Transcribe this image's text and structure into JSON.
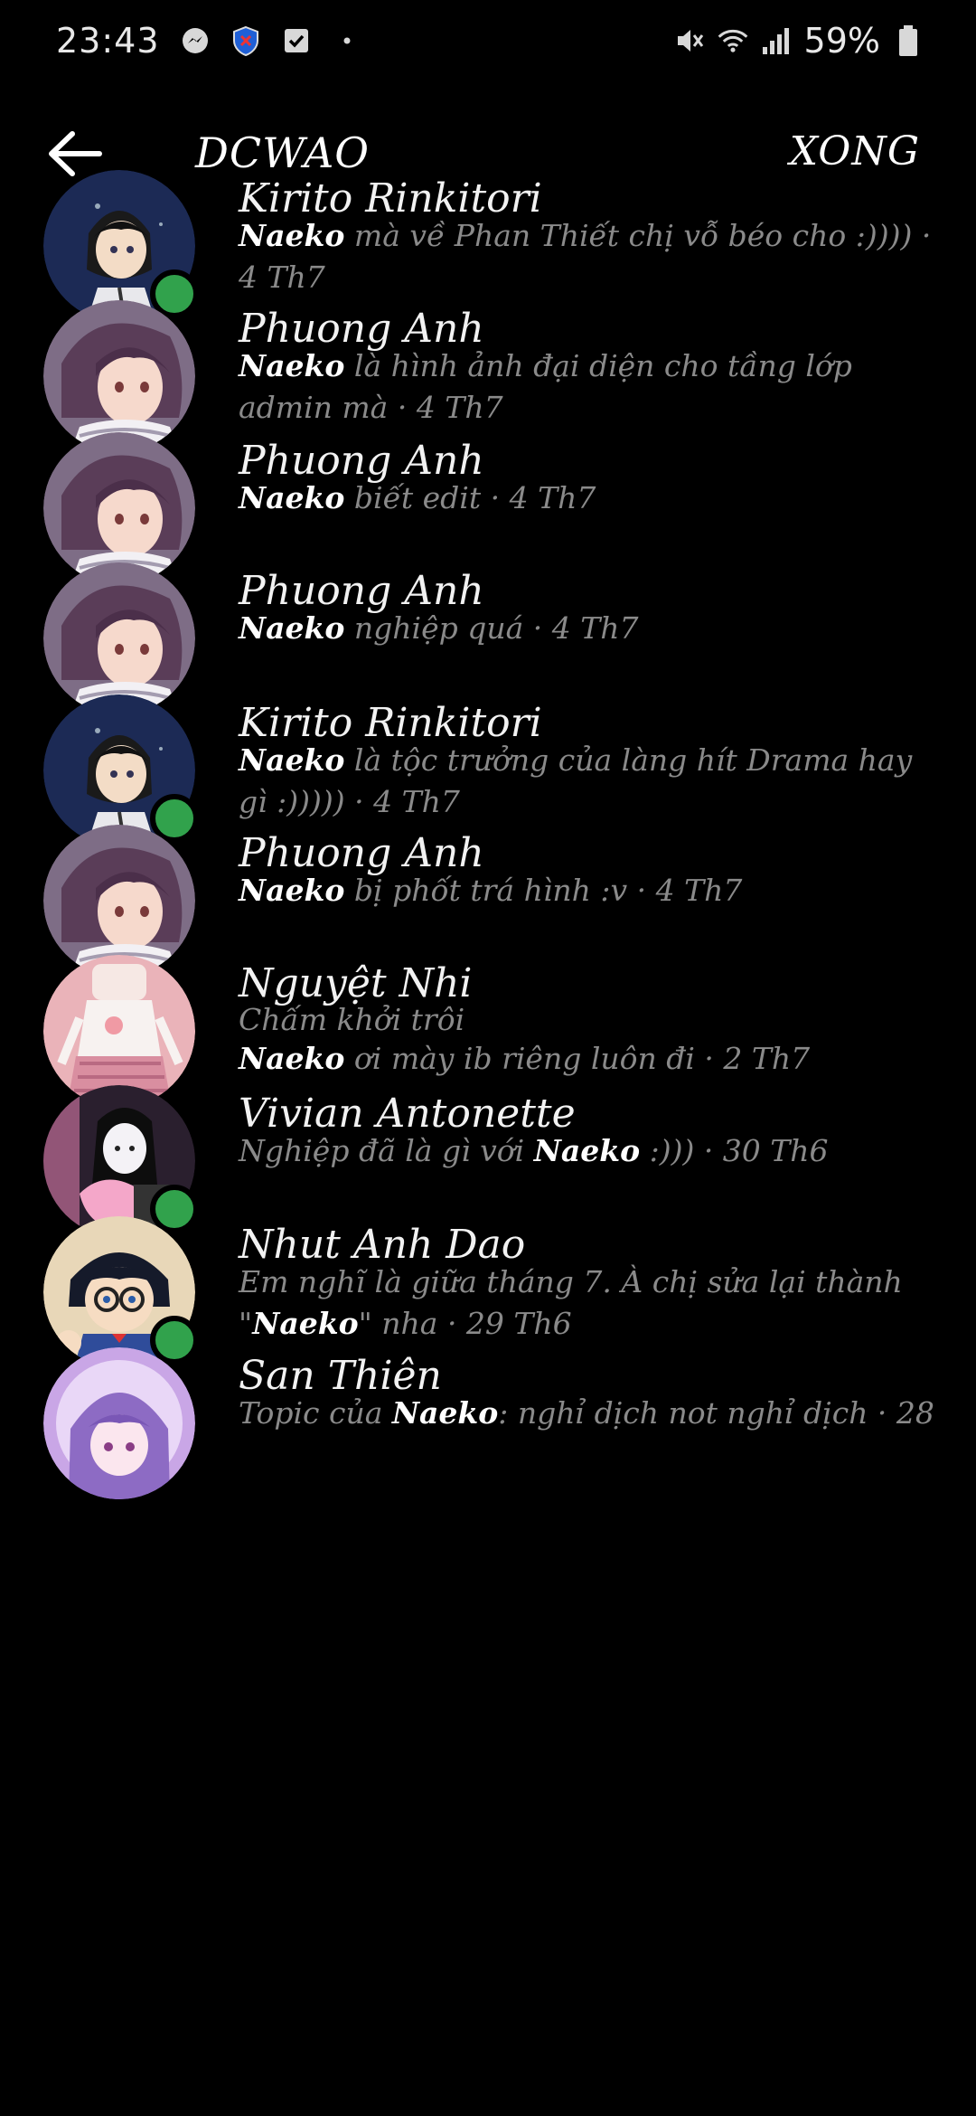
{
  "status_bar": {
    "time": "23:43",
    "battery": "59%",
    "left_icons": [
      "messenger-icon",
      "shield-icon",
      "checkbox-icon",
      "dot-icon"
    ],
    "right_icons": [
      "mute-icon",
      "wifi-icon",
      "signal-icon",
      "battery-icon"
    ]
  },
  "header": {
    "title": "DCWAO",
    "done_label": "XONG"
  },
  "rows": [
    {
      "name": "Kirito Rinkitori",
      "bold": "Naeko",
      "msg": " mà về Phan Thiết chị vỗ béo cho :)))) · 4 Th7",
      "online": true,
      "avatar": "kirito"
    },
    {
      "name": "Phuong Anh",
      "bold": "Naeko",
      "msg": " là hình ảnh đại diện cho tầng lớp admin mà · 4 Th7",
      "online": false,
      "avatar": "phuong"
    },
    {
      "name": "Phuong Anh",
      "bold": "Naeko",
      "msg": " biết edit · 4 Th7",
      "online": false,
      "avatar": "phuong"
    },
    {
      "name": "Phuong Anh",
      "bold": "Naeko",
      "msg": " nghiệp quá · 4 Th7",
      "online": false,
      "avatar": "phuong"
    },
    {
      "name": "Kirito Rinkitori",
      "bold": "Naeko",
      "msg": " là tộc trưởng của làng hít Drama hay gì :))))) · 4 Th7",
      "online": true,
      "avatar": "kirito"
    },
    {
      "name": "Phuong Anh",
      "bold": "Naeko",
      "msg": " bị phốt trá hình :v · 4 Th7",
      "online": false,
      "avatar": "phuong"
    },
    {
      "name": "Nguyệt Nhi",
      "sub": "Chấm khởi trôi",
      "bold": "Naeko",
      "msg": " ơi mày ib riêng luôn đi · 2 Th7",
      "online": false,
      "avatar": "nguyet"
    },
    {
      "name": "Vivian Antonette",
      "pre": "Nghiệp đã là gì với ",
      "bold": "Naeko",
      "msg": " :))) · 30 Th6",
      "online": true,
      "avatar": "vivian"
    },
    {
      "name": "Nhut Anh Dao",
      "pre": "Em nghĩ là giữa tháng 7. À chị sửa lại thành \"",
      "bold": "Naeko",
      "msg": "\" nha · 29 Th6",
      "online": true,
      "avatar": "conan"
    },
    {
      "name": "San Thiên",
      "pre": "Topic của ",
      "bold": "Naeko",
      "msg": ": nghỉ dịch not nghỉ dịch · 28",
      "online": false,
      "avatar": "san"
    }
  ]
}
